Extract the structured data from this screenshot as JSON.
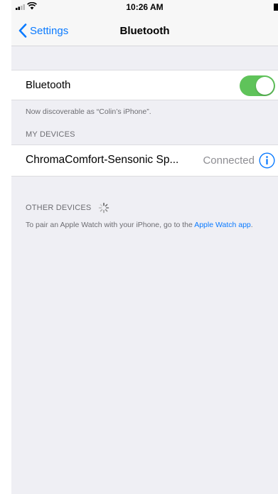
{
  "status_bar": {
    "time": "10:26 AM"
  },
  "nav": {
    "back_label": "Settings",
    "title": "Bluetooth"
  },
  "bluetooth": {
    "label": "Bluetooth",
    "enabled": true,
    "discoverable_text": "Now discoverable as “Colin’s iPhone”."
  },
  "my_devices": {
    "header": "MY DEVICES",
    "items": [
      {
        "name": "ChromaComfort-Sensonic Sp...",
        "status": "Connected"
      }
    ]
  },
  "other_devices": {
    "header": "OTHER DEVICES",
    "note_prefix": "To pair an Apple Watch with your iPhone, go to the ",
    "note_link": "Apple Watch app",
    "note_suffix": "."
  },
  "colors": {
    "accent": "#0a7aff",
    "toggle_on": "#5fc35a",
    "background": "#efeff4"
  },
  "icons": [
    "signal-icon",
    "wifi-icon",
    "battery-icon",
    "chevron-left-icon",
    "info-icon",
    "spinner-icon"
  ]
}
